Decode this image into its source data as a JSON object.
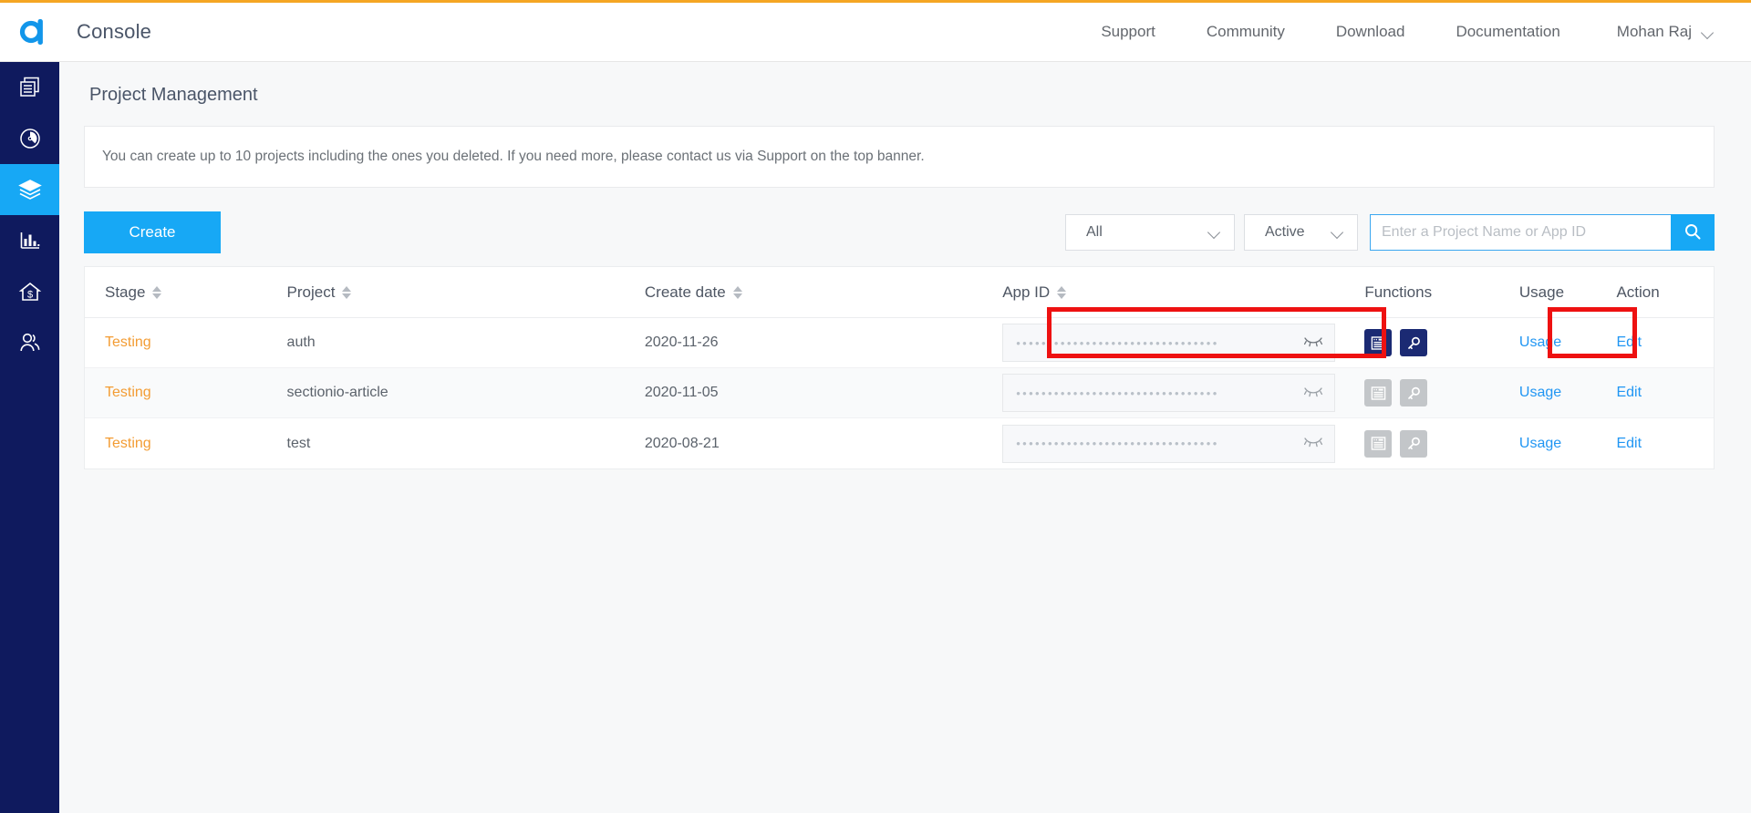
{
  "header": {
    "logo_icon": "agora-logo-icon",
    "title": "Console",
    "nav": [
      {
        "label": "Support"
      },
      {
        "label": "Community"
      },
      {
        "label": "Download"
      },
      {
        "label": "Documentation"
      }
    ],
    "user": {
      "name": "Mohan Raj",
      "chevron_icon": "chevron-down-icon"
    }
  },
  "sidebar": {
    "items": [
      {
        "name": "projects-icon",
        "active": false
      },
      {
        "name": "dashboard-icon",
        "active": false
      },
      {
        "name": "layers-icon",
        "active": true
      },
      {
        "name": "analytics-icon",
        "active": false
      },
      {
        "name": "billing-house-icon",
        "active": false
      },
      {
        "name": "users-icon",
        "active": false
      }
    ]
  },
  "page": {
    "title": "Project Management",
    "notice": "You can create up to 10 projects including the ones you deleted. If you need more, please contact us via Support on the top banner."
  },
  "toolbar": {
    "create_label": "Create",
    "filter_type": {
      "value": "All",
      "chevron_icon": "chevron-down-icon"
    },
    "filter_status": {
      "value": "Active",
      "chevron_icon": "chevron-down-icon"
    },
    "search": {
      "value": "",
      "placeholder": "Enter a Project Name or App ID",
      "button_icon": "search-icon"
    }
  },
  "table": {
    "columns": [
      {
        "label": "Stage",
        "sortable": true
      },
      {
        "label": "Project",
        "sortable": true
      },
      {
        "label": "Create date",
        "sortable": true
      },
      {
        "label": "App ID",
        "sortable": true
      },
      {
        "label": "Functions",
        "sortable": false
      },
      {
        "label": "Usage",
        "sortable": false
      },
      {
        "label": "Action",
        "sortable": false
      }
    ],
    "rows": [
      {
        "stage": "Testing",
        "project": "auth",
        "create_date": "2020-11-26",
        "app_id_masked": "••••••••••••••••••••••••••••••••",
        "app_id_toggle_icon": "eye-off-icon",
        "functions_enabled": true,
        "usage_label": "Usage",
        "action_label": "Edit"
      },
      {
        "stage": "Testing",
        "project": "sectionio-article",
        "create_date": "2020-11-05",
        "app_id_masked": "••••••••••••••••••••••••••••••••",
        "app_id_toggle_icon": "eye-off-icon",
        "functions_enabled": false,
        "usage_label": "Usage",
        "action_label": "Edit"
      },
      {
        "stage": "Testing",
        "project": "test",
        "create_date": "2020-08-21",
        "app_id_masked": "••••••••••••••••••••••••••••••••",
        "app_id_toggle_icon": "eye-off-icon",
        "functions_enabled": false,
        "usage_label": "Usage",
        "action_label": "Edit"
      }
    ]
  },
  "annotations": {
    "color": "#ee1111",
    "boxes": [
      {
        "name": "highlight-app-id-field"
      },
      {
        "name": "highlight-usage-link"
      }
    ]
  },
  "colors": {
    "accent_blue": "#17a8f5",
    "sidebar_navy": "#0f1a5e",
    "stage_orange": "#f39c33",
    "top_accent": "#f5a623",
    "link_blue": "#2196f3"
  }
}
